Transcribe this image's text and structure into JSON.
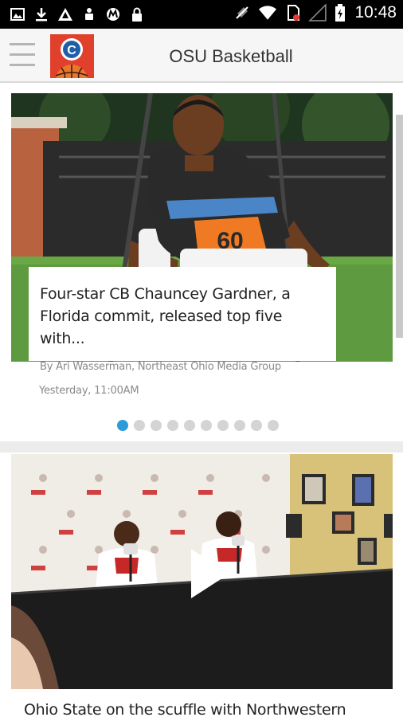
{
  "status_bar": {
    "time": "10:48",
    "icons": [
      "image-icon",
      "download-icon",
      "triangle-app-icon",
      "android-icon",
      "motorola-icon",
      "lock-icon",
      "mute-icon",
      "wifi-icon",
      "sim-alert-icon",
      "signal-icon",
      "battery-charging-icon"
    ]
  },
  "app_bar": {
    "title": "OSU Basketball",
    "menu_icon": "hamburger-icon",
    "logo_icon": "cleveland-basketball-logo"
  },
  "featured_story": {
    "headline": "Four-star CB Chauncey Gardner, a Florida commit, released top five with...",
    "byline": "By Ari Wasserman, Northeast Ohio Media Group",
    "timestamp": "Yesterday, 11:00AM",
    "page_count": 10,
    "active_page": 1,
    "jersey_number": "60"
  },
  "video_story": {
    "headline": "Ohio State on the scuffle with Northwestern",
    "play_icon": "play-icon"
  },
  "colors": {
    "accent": "#2d9bd8",
    "logo_red": "#e0402c",
    "logo_blue": "#1f5fa8"
  }
}
